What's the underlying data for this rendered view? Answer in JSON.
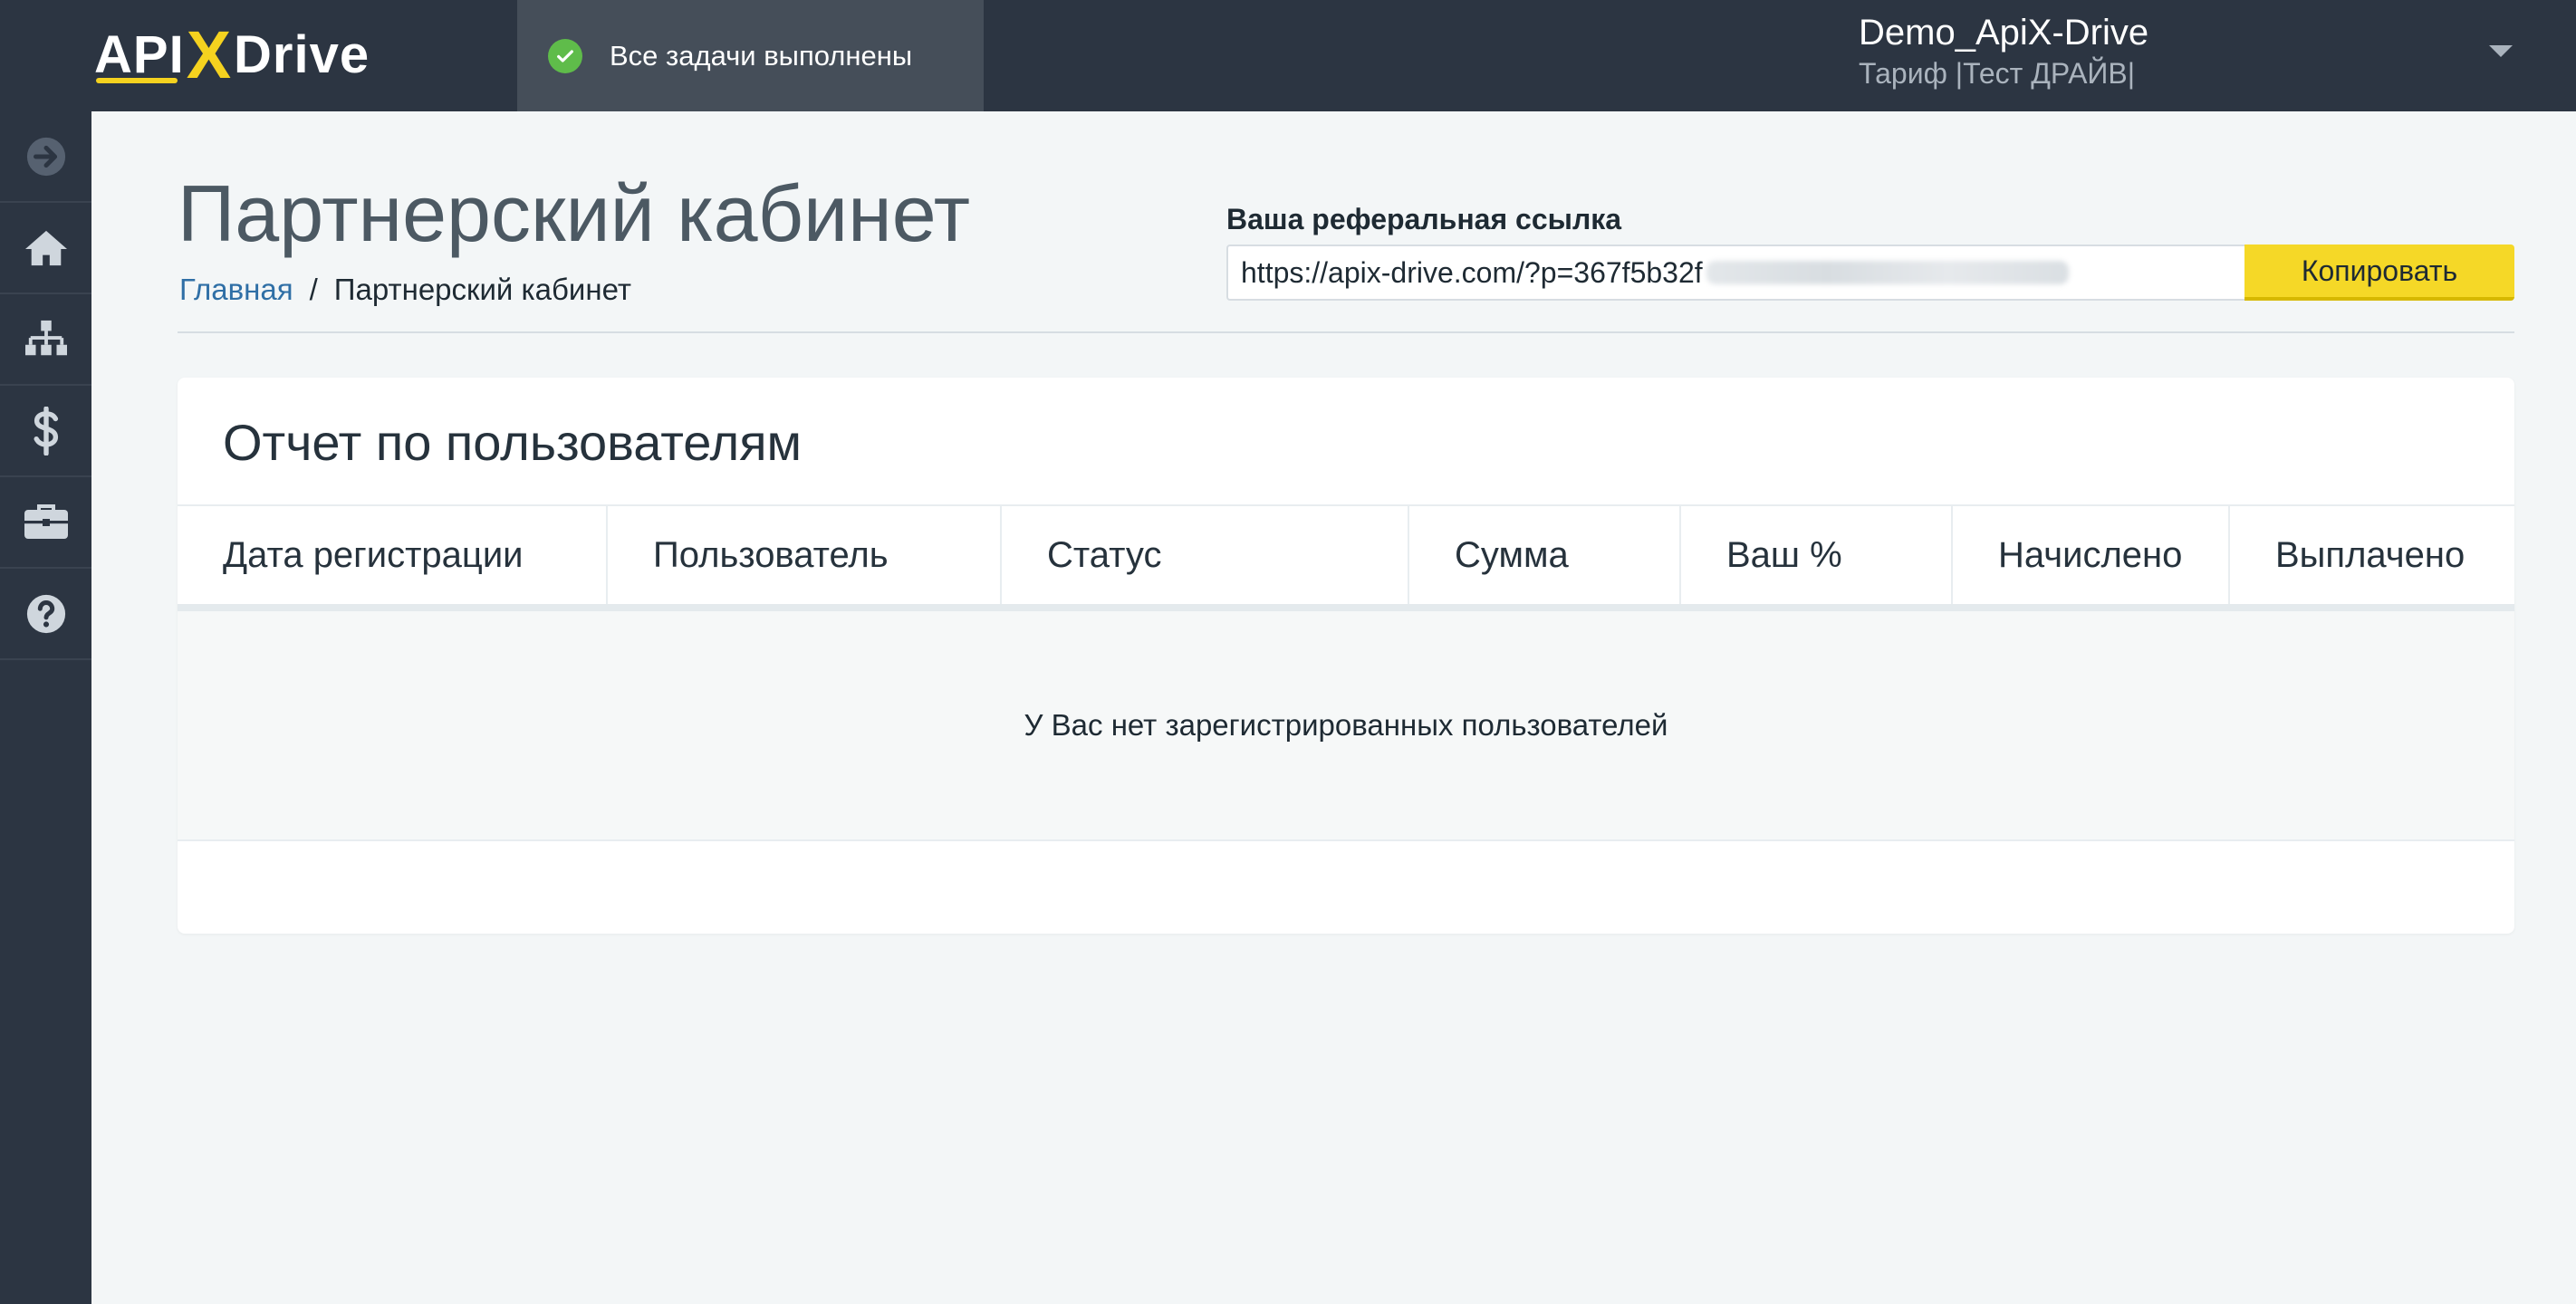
{
  "app": {
    "logo_api": "API",
    "logo_x": "X",
    "logo_drive": "Drive"
  },
  "topbar": {
    "status_text": "Все задачи выполнены",
    "account_name": "Demo_ApiX-Drive",
    "account_plan": "Тариф |Тест ДРАЙВ|"
  },
  "sidebar": {
    "items": [
      {
        "icon": "arrow-right-circle-icon"
      },
      {
        "icon": "home-icon"
      },
      {
        "icon": "sitemap-icon"
      },
      {
        "icon": "dollar-icon"
      },
      {
        "icon": "briefcase-icon"
      },
      {
        "icon": "question-circle-icon"
      }
    ]
  },
  "page": {
    "title": "Партнерский кабинет",
    "breadcrumb_home": "Главная",
    "breadcrumb_sep": "/",
    "breadcrumb_current": "Партнерский кабинет"
  },
  "referral": {
    "label": "Ваша реферальная ссылка",
    "link_visible": "https://apix-drive.com/?p=367f5b32f",
    "copy_label": "Копировать"
  },
  "report": {
    "title": "Отчет по пользователям",
    "columns": [
      "Дата регистрации",
      "Пользователь",
      "Статус",
      "Сумма",
      "Ваш %",
      "Начислено",
      "Выплачено"
    ],
    "empty_message": "У Вас нет зарегистрированных пользователей"
  },
  "colors": {
    "topbar_bg": "#2c3542",
    "accent_yellow": "#f5d827",
    "status_green": "#5fbc4a",
    "link_blue": "#2f6fa6"
  }
}
